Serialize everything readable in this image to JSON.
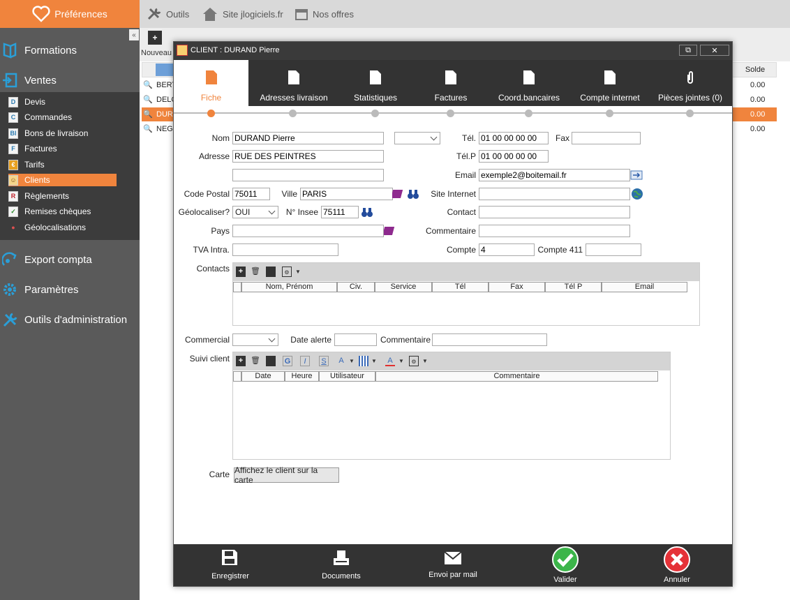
{
  "topbar": {
    "preferences": "Préférences",
    "links": [
      {
        "label": "Outils",
        "icon": "tools-icon"
      },
      {
        "label": "Site jlogiciels.fr",
        "icon": "home-icon"
      },
      {
        "label": "Nos offres",
        "icon": "calendar-icon"
      }
    ]
  },
  "sidebar": {
    "sections": [
      {
        "label": "Formations",
        "icon": "book-icon"
      },
      {
        "label": "Ventes",
        "icon": "sales-icon"
      },
      {
        "label": "Export compta",
        "icon": "export-icon"
      },
      {
        "label": "Paramètres",
        "icon": "gear-icon"
      },
      {
        "label": "Outils d'administration",
        "icon": "tools-icon"
      }
    ],
    "ventes_items": [
      {
        "label": "Devis",
        "glyph": "D"
      },
      {
        "label": "Commandes",
        "glyph": "C"
      },
      {
        "label": "Bons de livraison",
        "glyph": "Bl"
      },
      {
        "label": "Factures",
        "glyph": "F"
      },
      {
        "label": "Tarifs",
        "glyph": "€"
      },
      {
        "label": "Clients",
        "glyph": "☺",
        "active": true
      },
      {
        "label": "Règlements",
        "glyph": "R"
      },
      {
        "label": "Remises chèques",
        "glyph": "✓"
      },
      {
        "label": "Géolocalisations",
        "glyph": "●"
      }
    ],
    "collapse": "«"
  },
  "background": {
    "new_label": "Nouveau",
    "solde_header": "Solde",
    "rows": [
      {
        "name": "BERT",
        "solde": "0.00"
      },
      {
        "name": "DELC",
        "solde": "0.00"
      },
      {
        "name": "DURA",
        "solde": "0.00",
        "selected": true
      },
      {
        "name": "NEGO",
        "solde": "0.00"
      }
    ]
  },
  "dialog": {
    "title": "CLIENT : DURAND Pierre",
    "restore": "⧉",
    "close": "✕",
    "tabs": [
      {
        "label": "Fiche",
        "active": true
      },
      {
        "label": "Adresses livraison"
      },
      {
        "label": "Statistiques"
      },
      {
        "label": "Factures"
      },
      {
        "label": "Coord.bancaires"
      },
      {
        "label": "Compte internet"
      },
      {
        "label": "Pièces jointes (0)"
      }
    ],
    "form": {
      "nom_label": "Nom",
      "nom": "DURAND Pierre",
      "adresse_label": "Adresse",
      "adresse": "RUE DES PEINTRES",
      "adresse2": "",
      "cp_label": "Code Postal",
      "cp": "75011",
      "ville_label": "Ville",
      "ville": "PARIS",
      "geo_label": "Géolocaliser?",
      "geo": "OUI",
      "insee_label": "N° Insee",
      "insee": "75111",
      "pays_label": "Pays",
      "pays": "",
      "tva_label": "TVA Intra.",
      "tva": "",
      "tel_label": "Tél.",
      "tel": "01 00 00 00 00",
      "fax_label": "Fax",
      "fax": "",
      "telp_label": "Tél.P",
      "telp": "01 00 00 00 00",
      "email_label": "Email",
      "email": "exemple2@boitemail.fr",
      "site_label": "Site Internet",
      "site": "",
      "contact_label": "Contact",
      "contact": "",
      "commentaire_label": "Commentaire",
      "commentaire": "",
      "compte_label": "Compte",
      "compte": "4",
      "compte411_label": "Compte 411",
      "compte411": "",
      "contacts_label": "Contacts",
      "contacts_cols": [
        "Nom, Prénom",
        "Civ.",
        "Service",
        "Tél",
        "Fax",
        "Tél P",
        "Email"
      ],
      "commercial_label": "Commercial",
      "commercial": "",
      "date_alerte_label": "Date alerte",
      "date_alerte": "",
      "commentaire2_label": "Commentaire",
      "commentaire2": "",
      "suivi_label": "Suivi client",
      "suivi_cols": [
        "Date",
        "Heure",
        "Utilisateur",
        "Commentaire"
      ],
      "carte_label": "Carte",
      "carte_button": "Affichez le client sur la carte"
    },
    "footer": [
      {
        "label": "Enregistrer",
        "icon": "save-icon"
      },
      {
        "label": "Documents",
        "icon": "printer-icon"
      },
      {
        "label": "Envoi par mail",
        "icon": "mail-icon"
      },
      {
        "label": "Valider",
        "icon": "check-icon"
      },
      {
        "label": "Annuler",
        "icon": "cancel-icon"
      }
    ]
  },
  "colors": {
    "accent": "#f0843d",
    "dark": "#333333",
    "sidebar": "#5a5a5a",
    "valider": "#3cb54a",
    "annuler": "#e53238"
  }
}
